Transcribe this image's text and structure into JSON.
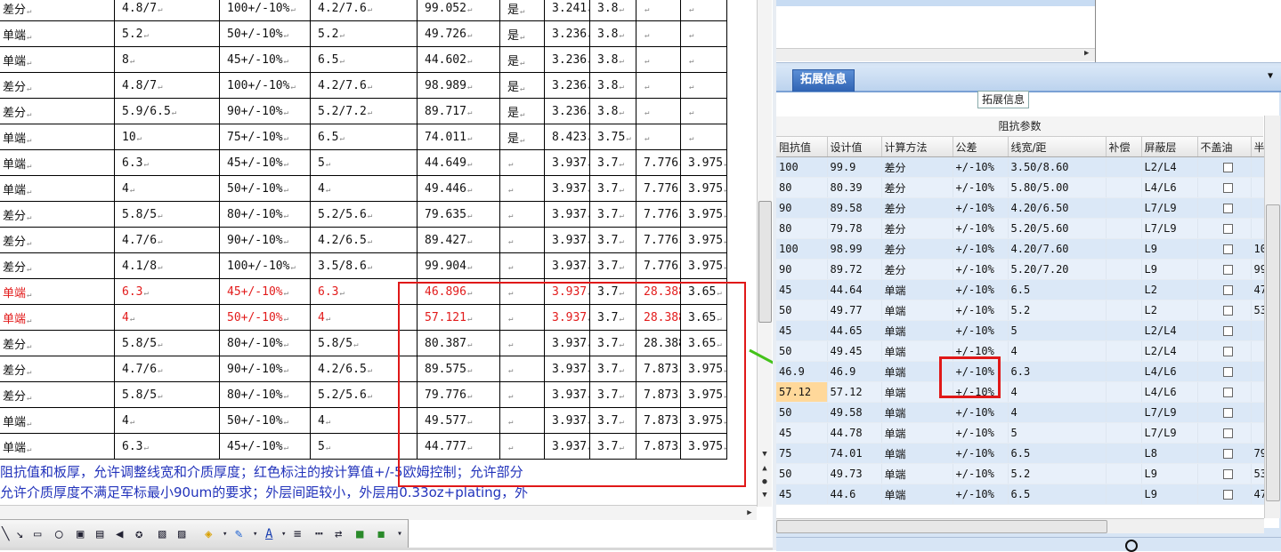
{
  "doc_rows": [
    {
      "cells": [
        "差分",
        "4.8/7",
        "100+/-10%",
        "4.2/7.6",
        "99.052",
        "是",
        "3.241",
        "3.8",
        "",
        ""
      ],
      "red": false
    },
    {
      "cells": [
        "单端",
        "5.2",
        "50+/-10%",
        "5.2",
        "49.726",
        "是",
        "3.236",
        "3.8",
        "",
        ""
      ],
      "red": false
    },
    {
      "cells": [
        "单端",
        "8",
        "45+/-10%",
        "6.5",
        "44.602",
        "是",
        "3.236",
        "3.8",
        "",
        ""
      ],
      "red": false
    },
    {
      "cells": [
        "差分",
        "4.8/7",
        "100+/-10%",
        "4.2/7.6",
        "98.989",
        "是",
        "3.236",
        "3.8",
        "",
        ""
      ],
      "red": false
    },
    {
      "cells": [
        "差分",
        "5.9/6.5",
        "90+/-10%",
        "5.2/7.2",
        "89.717",
        "是",
        "3.236",
        "3.8",
        "",
        ""
      ],
      "red": false
    },
    {
      "cells": [
        "单端",
        "10",
        "75+/-10%",
        "6.5",
        "74.011",
        "是",
        "8.423",
        "3.75",
        "",
        ""
      ],
      "red": false
    },
    {
      "cells": [
        "单端",
        "6.3",
        "45+/-10%",
        "5",
        "44.649",
        "",
        "3.937",
        "3.7",
        "7.776",
        "3.975"
      ],
      "red": false
    },
    {
      "cells": [
        "单端",
        "4",
        "50+/-10%",
        "4",
        "49.446",
        "",
        "3.937",
        "3.7",
        "7.776",
        "3.975"
      ],
      "red": false
    },
    {
      "cells": [
        "差分",
        "5.8/5",
        "80+/-10%",
        "5.2/5.6",
        "79.635",
        "",
        "3.937",
        "3.7",
        "7.776",
        "3.975"
      ],
      "red": false
    },
    {
      "cells": [
        "差分",
        "4.7/6",
        "90+/-10%",
        "4.2/6.5",
        "89.427",
        "",
        "3.937",
        "3.7",
        "7.776",
        "3.975"
      ],
      "red": false
    },
    {
      "cells": [
        "差分",
        "4.1/8",
        "100+/-10%",
        "3.5/8.6",
        "99.904",
        "",
        "3.937",
        "3.7",
        "7.776",
        "3.975"
      ],
      "red": false
    },
    {
      "cells": [
        "单端",
        "6.3",
        "45+/-10%",
        "6.3",
        "46.896",
        "",
        "3.937",
        "3.7",
        "28.388",
        "3.65"
      ],
      "red": true
    },
    {
      "cells": [
        "单端",
        "4",
        "50+/-10%",
        "4",
        "57.121",
        "",
        "3.937",
        "3.7",
        "28.388",
        "3.65"
      ],
      "red": true
    },
    {
      "cells": [
        "差分",
        "5.8/5",
        "80+/-10%",
        "5.8/5",
        "80.387",
        "",
        "3.937",
        "3.7",
        "28.388",
        "3.65"
      ],
      "red": false
    },
    {
      "cells": [
        "差分",
        "4.7/6",
        "90+/-10%",
        "4.2/6.5",
        "89.575",
        "",
        "3.937",
        "3.7",
        "7.873",
        "3.975"
      ],
      "red": false
    },
    {
      "cells": [
        "差分",
        "5.8/5",
        "80+/-10%",
        "5.2/5.6",
        "79.776",
        "",
        "3.937",
        "3.7",
        "7.873",
        "3.975"
      ],
      "red": false
    },
    {
      "cells": [
        "单端",
        "4",
        "50+/-10%",
        "4",
        "49.577",
        "",
        "3.937",
        "3.7",
        "7.873",
        "3.975"
      ],
      "red": false
    },
    {
      "cells": [
        "单端",
        "6.3",
        "45+/-10%",
        "5",
        "44.777",
        "",
        "3.937",
        "3.7",
        "7.873",
        "3.975"
      ],
      "red": false
    }
  ],
  "note": {
    "line1": "阻抗值和板厚，允许调整线宽和介质厚度；红色标注的按计算值+/-5欧姆控制；允许部分",
    "line2": "  允许介质厚度不满足军标最小90um的要求；外层间距较小，外层用0.33oz+plating，外"
  },
  "right": {
    "tab_label": "拓展信息",
    "group_label": "拓展信息",
    "table_title": "阻抗参数",
    "headers": [
      "阻抗值",
      "设计值",
      "计算方法",
      "公差",
      "线宽/距",
      "补偿",
      "屏蔽层",
      "不盖油",
      "半"
    ],
    "rows": [
      [
        "100",
        "99.9",
        "差分",
        "+/-10%",
        "3.50/8.60",
        "",
        "L2/L4",
        ""
      ],
      [
        "80",
        "80.39",
        "差分",
        "+/-10%",
        "5.80/5.00",
        "",
        "L4/L6",
        ""
      ],
      [
        "90",
        "89.58",
        "差分",
        "+/-10%",
        "4.20/6.50",
        "",
        "L7/L9",
        ""
      ],
      [
        "80",
        "79.78",
        "差分",
        "+/-10%",
        "5.20/5.60",
        "",
        "L7/L9",
        ""
      ],
      [
        "100",
        "98.99",
        "差分",
        "+/-10%",
        "4.20/7.60",
        "",
        "L9",
        "10"
      ],
      [
        "90",
        "89.72",
        "差分",
        "+/-10%",
        "5.20/7.20",
        "",
        "L9",
        "99"
      ],
      [
        "45",
        "44.64",
        "单端",
        "+/-10%",
        "6.5",
        "",
        "L2",
        "47"
      ],
      [
        "50",
        "49.77",
        "单端",
        "+/-10%",
        "5.2",
        "",
        "L2",
        "53"
      ],
      [
        "45",
        "44.65",
        "单端",
        "+/-10%",
        "5",
        "",
        "L2/L4",
        ""
      ],
      [
        "50",
        "49.45",
        "单端",
        "+/-10%",
        "4",
        "",
        "L2/L4",
        ""
      ],
      [
        "46.9",
        "46.9",
        "单端",
        "+/-10%",
        "6.3",
        "",
        "L4/L6",
        ""
      ],
      [
        "57.12",
        "57.12",
        "单端",
        "+/-10%",
        "4",
        "",
        "L4/L6",
        ""
      ],
      [
        "50",
        "49.58",
        "单端",
        "+/-10%",
        "4",
        "",
        "L7/L9",
        ""
      ],
      [
        "45",
        "44.78",
        "单端",
        "+/-10%",
        "5",
        "",
        "L7/L9",
        ""
      ],
      [
        "75",
        "74.01",
        "单端",
        "+/-10%",
        "6.5",
        "",
        "L8",
        "79"
      ],
      [
        "50",
        "49.73",
        "单端",
        "+/-10%",
        "5.2",
        "",
        "L9",
        "53"
      ],
      [
        "45",
        "44.6",
        "单端",
        "+/-10%",
        "6.5",
        "",
        "L9",
        "47"
      ]
    ]
  },
  "colors": {
    "red_text": "#e21b1b",
    "highlight": "#ffd89a",
    "note_blue": "#2233bb",
    "annotation_red": "#e01818",
    "arrow_green": "#44c21a"
  }
}
